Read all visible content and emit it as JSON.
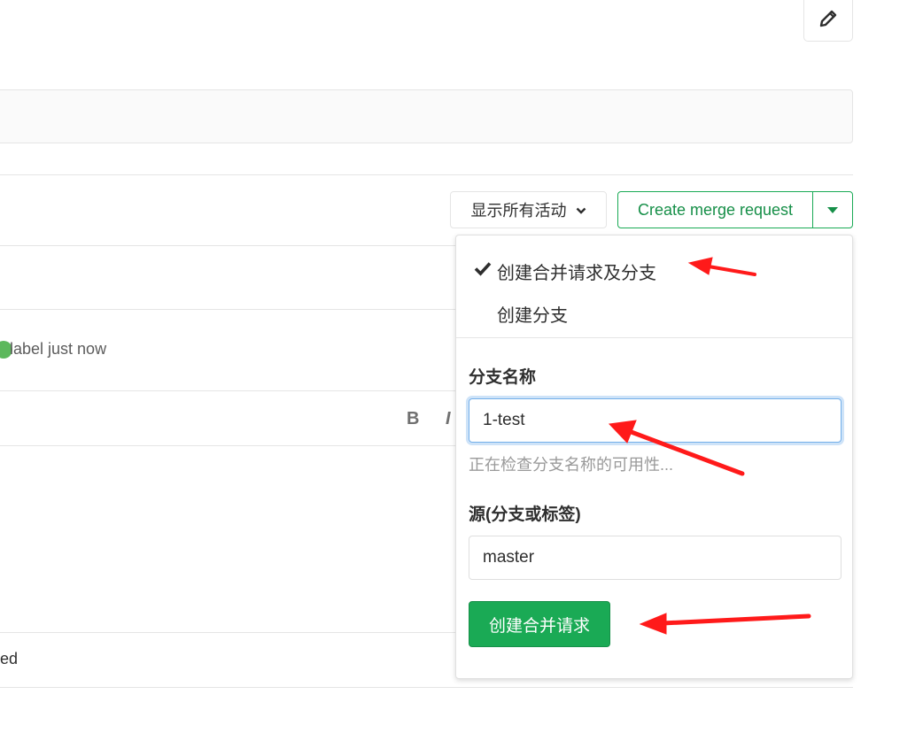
{
  "header": {
    "edit_icon": "pencil-icon"
  },
  "activity_filter": {
    "label": "显示所有活动",
    "icon": "chevron-down-icon"
  },
  "merge_request_button": {
    "label": "Create merge request",
    "caret_icon": "caret-down-icon"
  },
  "timeline": {
    "event_text": "label just now"
  },
  "editor": {
    "bold_label": "B",
    "italic_label": "I"
  },
  "footer_partial_text": "ed",
  "dropdown": {
    "options": [
      {
        "label": "创建合并请求及分支",
        "selected": true
      },
      {
        "label": "创建分支",
        "selected": false
      }
    ],
    "branch_field": {
      "label": "分支名称",
      "value": "1-test",
      "hint": "正在检查分支名称的可用性..."
    },
    "source_field": {
      "label": "源(分支或标签)",
      "value": "master"
    },
    "submit_label": "创建合并请求"
  },
  "colors": {
    "accent_green": "#1aaa55",
    "annotation_red": "#ff1a1a",
    "focus_blue": "#73afea"
  }
}
